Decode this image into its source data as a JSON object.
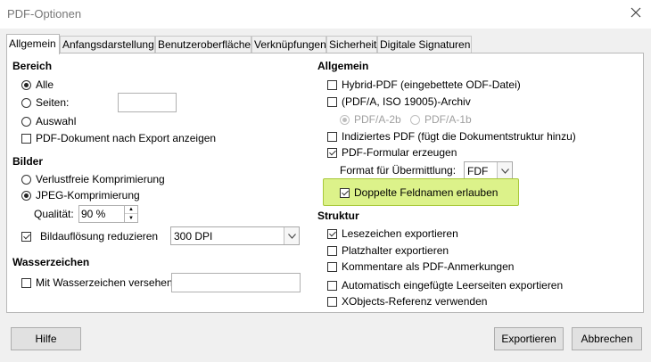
{
  "window": {
    "title": "PDF-Optionen",
    "close_icon": "close-icon"
  },
  "tabs": [
    {
      "label": "Allgemein",
      "active": true
    },
    {
      "label": "Anfangsdarstellung",
      "active": false
    },
    {
      "label": "Benutzeroberfläche",
      "active": false
    },
    {
      "label": "Verknüpfungen",
      "active": false
    },
    {
      "label": "Sicherheit",
      "active": false
    },
    {
      "label": "Digitale Signaturen",
      "active": false
    }
  ],
  "left": {
    "bereich": {
      "heading": "Bereich",
      "alle": {
        "label": "Alle",
        "checked": true
      },
      "seiten": {
        "label": "Seiten:",
        "checked": false,
        "value": ""
      },
      "auswahl": {
        "label": "Auswahl",
        "checked": false
      },
      "pdf_nach_export": {
        "label": "PDF-Dokument nach Export anzeigen",
        "checked": false
      }
    },
    "bilder": {
      "heading": "Bilder",
      "verlustfrei": {
        "label": "Verlustfreie Komprimierung",
        "checked": false
      },
      "jpeg": {
        "label": "JPEG-Komprimierung",
        "checked": true
      },
      "qualitaet_label": "Qualität:",
      "qualitaet_value": "90 %",
      "aufloesung": {
        "label": "Bildauflösung reduzieren",
        "checked": true
      },
      "dpi_value": "300 DPI"
    },
    "wasserzeichen": {
      "heading": "Wasserzeichen",
      "mit": {
        "label": "Mit Wasserzeichen versehen",
        "checked": false,
        "value": ""
      }
    }
  },
  "right": {
    "allgemein": {
      "heading": "Allgemein",
      "hybrid": {
        "label": "Hybrid-PDF (eingebettete ODF-Datei)",
        "checked": false
      },
      "pdfa": {
        "label": "(PDF/A, ISO 19005)-Archiv",
        "checked": false
      },
      "pdfa2b": {
        "label": "PDF/A-2b",
        "checked": true,
        "disabled": true
      },
      "pdfa1b": {
        "label": "PDF/A-1b",
        "checked": false,
        "disabled": true
      },
      "indiziert": {
        "label": "Indiziertes PDF (fügt die Dokumentstruktur hinzu)",
        "checked": false
      },
      "formular": {
        "label": "PDF-Formular erzeugen",
        "checked": true
      },
      "format_label": "Format für Übermittlung:",
      "format_value": "FDF",
      "doppelte": {
        "label": "Doppelte Feldnamen erlauben",
        "checked": true
      }
    },
    "struktur": {
      "heading": "Struktur",
      "lesezeichen": {
        "label": "Lesezeichen exportieren",
        "checked": true
      },
      "platzhalter": {
        "label": "Platzhalter exportieren",
        "checked": false
      },
      "kommentare": {
        "label": "Kommentare als PDF-Anmerkungen",
        "checked": false
      },
      "leerseiten": {
        "label": "Automatisch eingefügte Leerseiten exportieren",
        "checked": false
      },
      "xobjects": {
        "label": "XObjects-Referenz verwenden",
        "checked": false
      }
    }
  },
  "buttons": {
    "hilfe": "Hilfe",
    "exportieren": "Exportieren",
    "abbrechen": "Abbrechen"
  },
  "colors": {
    "highlight": "#dcf28a",
    "highlight_border": "#a8c83a"
  }
}
